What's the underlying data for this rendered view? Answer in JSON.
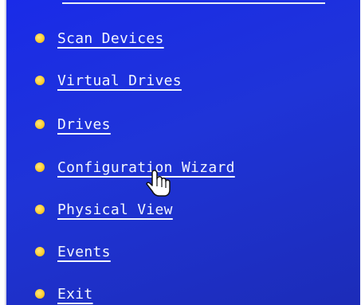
{
  "menu": {
    "items": [
      {
        "label": "Scan Devices"
      },
      {
        "label": "Virtual Drives"
      },
      {
        "label": "Drives"
      },
      {
        "label": "Configuration Wizard"
      },
      {
        "label": "Physical View"
      },
      {
        "label": "Events"
      },
      {
        "label": "Exit"
      }
    ]
  },
  "colors": {
    "background": "#1c2fe0",
    "text": "#f2f6ff",
    "bullet": "#ffd23a"
  },
  "icons": {
    "bullet": "bullet-dot-icon",
    "cursor": "hand-pointer-icon"
  }
}
